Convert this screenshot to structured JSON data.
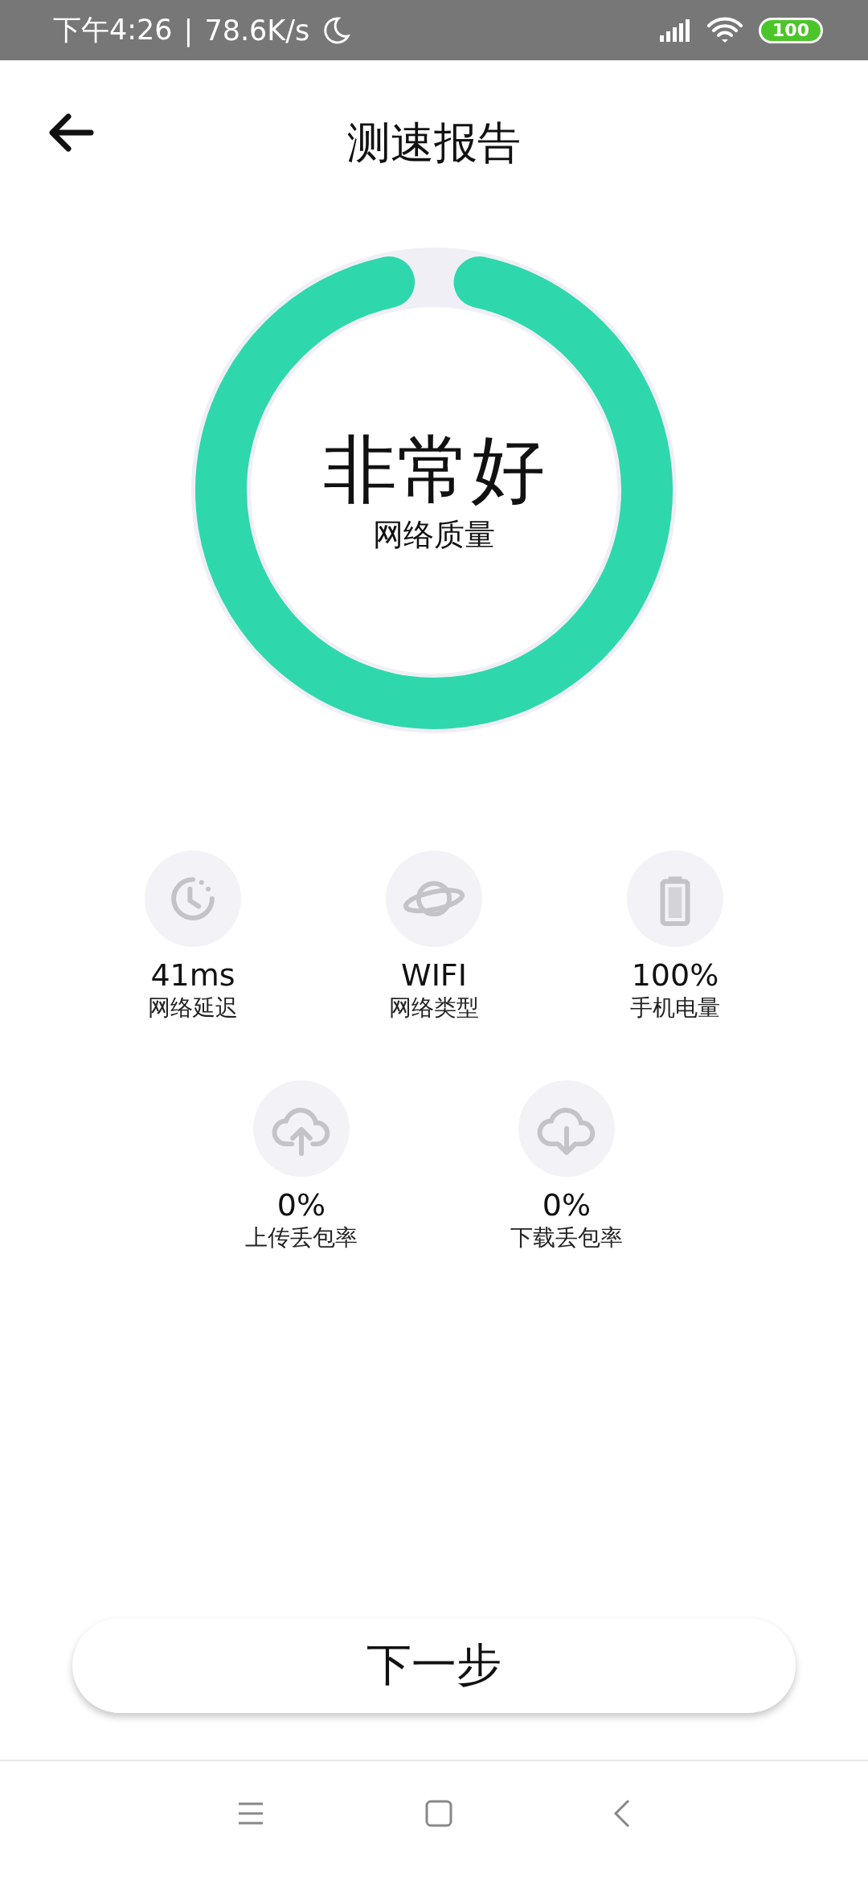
{
  "status_bar": {
    "time": "下午4:26",
    "separator": "|",
    "speed": "78.6K/s",
    "battery": "100"
  },
  "header": {
    "title": "测速报告"
  },
  "gauge": {
    "level": 0.97,
    "rating": "非常好",
    "caption": "网络质量"
  },
  "metric_rows": [
    {
      "items": [
        {
          "kind": "latency",
          "value": "41ms",
          "label": "网络延迟"
        },
        {
          "kind": "network",
          "value": "WIFI",
          "label": "网络类型"
        },
        {
          "kind": "battery",
          "value": "100%",
          "label": "手机电量"
        }
      ]
    },
    {
      "items": [
        {
          "kind": "upload",
          "value": "0%",
          "label": "上传丢包率"
        },
        {
          "kind": "download",
          "value": "0%",
          "label": "下载丢包率"
        }
      ]
    }
  ],
  "next_button": "下一步"
}
